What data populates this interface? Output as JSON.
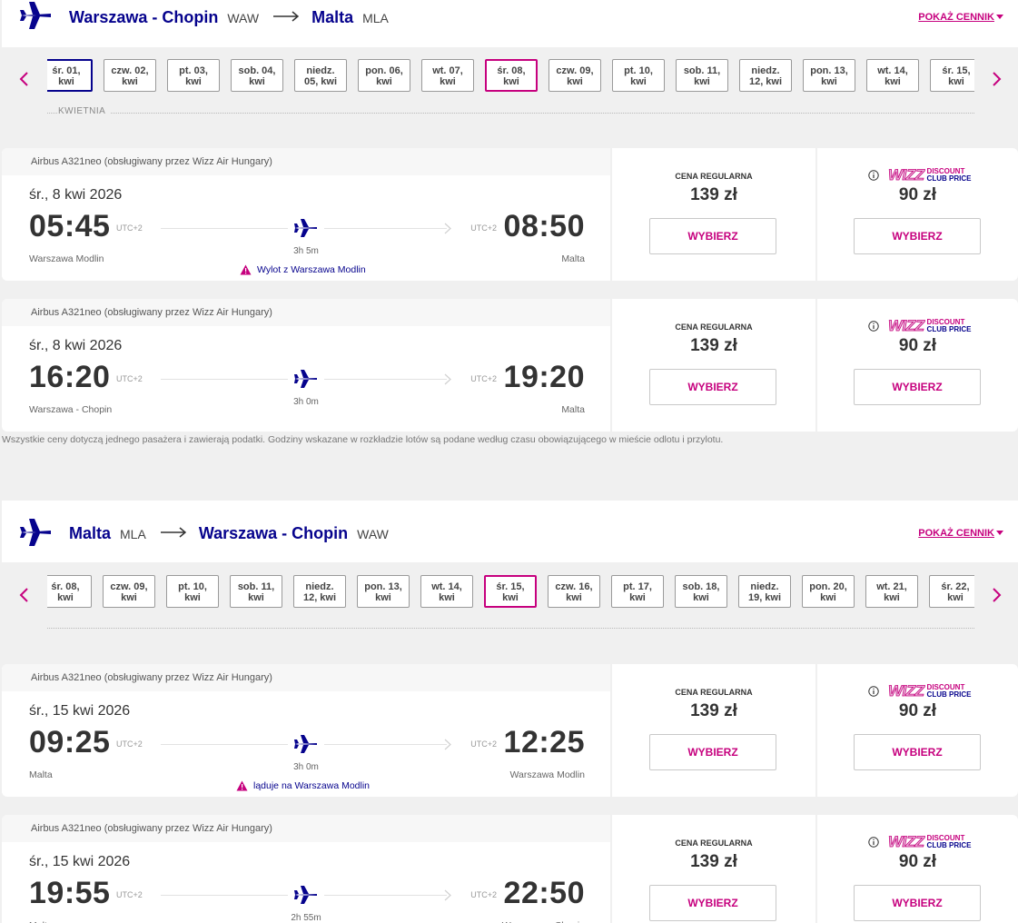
{
  "outbound": {
    "header": {
      "from_city": "Warszawa - Chopin",
      "from_code": "WAW",
      "to_city": "Malta",
      "to_code": "MLA",
      "pricelist_label": "POKAŻ CENNIK"
    },
    "dates": [
      {
        "l1": "śr. 01,",
        "l2": "kwi",
        "state": "focused"
      },
      {
        "l1": "czw. 02,",
        "l2": "kwi",
        "state": ""
      },
      {
        "l1": "pt. 03,",
        "l2": "kwi",
        "state": ""
      },
      {
        "l1": "sob. 04,",
        "l2": "kwi",
        "state": ""
      },
      {
        "l1": "niedz.",
        "l2": "05, kwi",
        "state": ""
      },
      {
        "l1": "pon. 06,",
        "l2": "kwi",
        "state": ""
      },
      {
        "l1": "wt. 07,",
        "l2": "kwi",
        "state": ""
      },
      {
        "l1": "śr. 08,",
        "l2": "kwi",
        "state": "selected"
      },
      {
        "l1": "czw. 09,",
        "l2": "kwi",
        "state": ""
      },
      {
        "l1": "pt. 10,",
        "l2": "kwi",
        "state": ""
      },
      {
        "l1": "sob. 11,",
        "l2": "kwi",
        "state": ""
      },
      {
        "l1": "niedz.",
        "l2": "12, kwi",
        "state": ""
      },
      {
        "l1": "pon. 13,",
        "l2": "kwi",
        "state": ""
      },
      {
        "l1": "wt. 14,",
        "l2": "kwi",
        "state": ""
      },
      {
        "l1": "śr. 15,",
        "l2": "kwi",
        "state": ""
      }
    ],
    "month_label": "KWIETNIA",
    "flights": [
      {
        "aircraft": "Airbus A321neo (obsługiwany przez Wizz Air Hungary)",
        "date": "śr., 8 kwi 2026",
        "dep_time": "05:45",
        "dep_utc": "UTC+2",
        "arr_time": "08:50",
        "arr_utc": "UTC+2",
        "duration": "3h 5m",
        "dep_airport": "Warszawa Modlin",
        "arr_airport": "Malta",
        "warning": "Wylot z Warszawa Modlin",
        "regular_label": "CENA REGULARNA",
        "regular_price": "139 zł",
        "club_price": "90 zł",
        "regular_btn": "WYBIERZ",
        "club_btn": "WYBIERZ"
      },
      {
        "aircraft": "Airbus A321neo (obsługiwany przez Wizz Air Hungary)",
        "date": "śr., 8 kwi 2026",
        "dep_time": "16:20",
        "dep_utc": "UTC+2",
        "arr_time": "19:20",
        "arr_utc": "UTC+2",
        "duration": "3h 0m",
        "dep_airport": "Warszawa - Chopin",
        "arr_airport": "Malta",
        "warning": "",
        "regular_label": "CENA REGULARNA",
        "regular_price": "139 zł",
        "club_price": "90 zł",
        "regular_btn": "WYBIERZ",
        "club_btn": "WYBIERZ"
      }
    ]
  },
  "disclaimer": "Wszystkie ceny dotyczą jednego pasażera i zawierają podatki. Godziny wskazane w rozkładzie lotów są podane według czasu obowiązującego w mieście odlotu i przylotu.",
  "return": {
    "header": {
      "from_city": "Malta",
      "from_code": "MLA",
      "to_city": "Warszawa - Chopin",
      "to_code": "WAW",
      "pricelist_label": "POKAŻ CENNIK"
    },
    "dates": [
      {
        "l1": "śr. 08,",
        "l2": "kwi",
        "state": ""
      },
      {
        "l1": "czw. 09,",
        "l2": "kwi",
        "state": ""
      },
      {
        "l1": "pt. 10,",
        "l2": "kwi",
        "state": ""
      },
      {
        "l1": "sob. 11,",
        "l2": "kwi",
        "state": ""
      },
      {
        "l1": "niedz.",
        "l2": "12, kwi",
        "state": ""
      },
      {
        "l1": "pon. 13,",
        "l2": "kwi",
        "state": ""
      },
      {
        "l1": "wt. 14,",
        "l2": "kwi",
        "state": ""
      },
      {
        "l1": "śr. 15,",
        "l2": "kwi",
        "state": "selected"
      },
      {
        "l1": "czw. 16,",
        "l2": "kwi",
        "state": ""
      },
      {
        "l1": "pt. 17,",
        "l2": "kwi",
        "state": ""
      },
      {
        "l1": "sob. 18,",
        "l2": "kwi",
        "state": ""
      },
      {
        "l1": "niedz.",
        "l2": "19, kwi",
        "state": ""
      },
      {
        "l1": "pon. 20,",
        "l2": "kwi",
        "state": ""
      },
      {
        "l1": "wt. 21,",
        "l2": "kwi",
        "state": ""
      },
      {
        "l1": "śr. 22,",
        "l2": "kwi",
        "state": ""
      }
    ],
    "month_label": "",
    "flights": [
      {
        "aircraft": "Airbus A321neo (obsługiwany przez Wizz Air Hungary)",
        "date": "śr., 15 kwi 2026",
        "dep_time": "09:25",
        "dep_utc": "UTC+2",
        "arr_time": "12:25",
        "arr_utc": "UTC+2",
        "duration": "3h 0m",
        "dep_airport": "Malta",
        "arr_airport": "Warszawa Modlin",
        "warning": "ląduje na Warszawa Modlin",
        "regular_label": "CENA REGULARNA",
        "regular_price": "139 zł",
        "club_price": "90 zł",
        "regular_btn": "WYBIERZ",
        "club_btn": "WYBIERZ"
      },
      {
        "aircraft": "Airbus A321neo (obsługiwany przez Wizz Air Hungary)",
        "date": "śr., 15 kwi 2026",
        "dep_time": "19:55",
        "dep_utc": "UTC+2",
        "arr_time": "22:50",
        "arr_utc": "UTC+2",
        "duration": "2h 55m",
        "dep_airport": "Malta",
        "arr_airport": "Warszawa - Chopin",
        "warning": "",
        "regular_label": "CENA REGULARNA",
        "regular_price": "139 zł",
        "club_price": "90 zł",
        "regular_btn": "WYBIERZ",
        "club_btn": "WYBIERZ"
      }
    ]
  },
  "club_logo": {
    "wizz": "WIZZ",
    "line1": "DISCOUNT",
    "line2": "CLUB PRICE"
  },
  "icons": {
    "logo": "plane-icon",
    "prev": "chevron-left-icon",
    "next": "chevron-right-icon",
    "warning": "warning-triangle-icon",
    "info": "info-icon"
  },
  "colors": {
    "brand_navy": "#06038d",
    "brand_magenta": "#c6007e"
  }
}
